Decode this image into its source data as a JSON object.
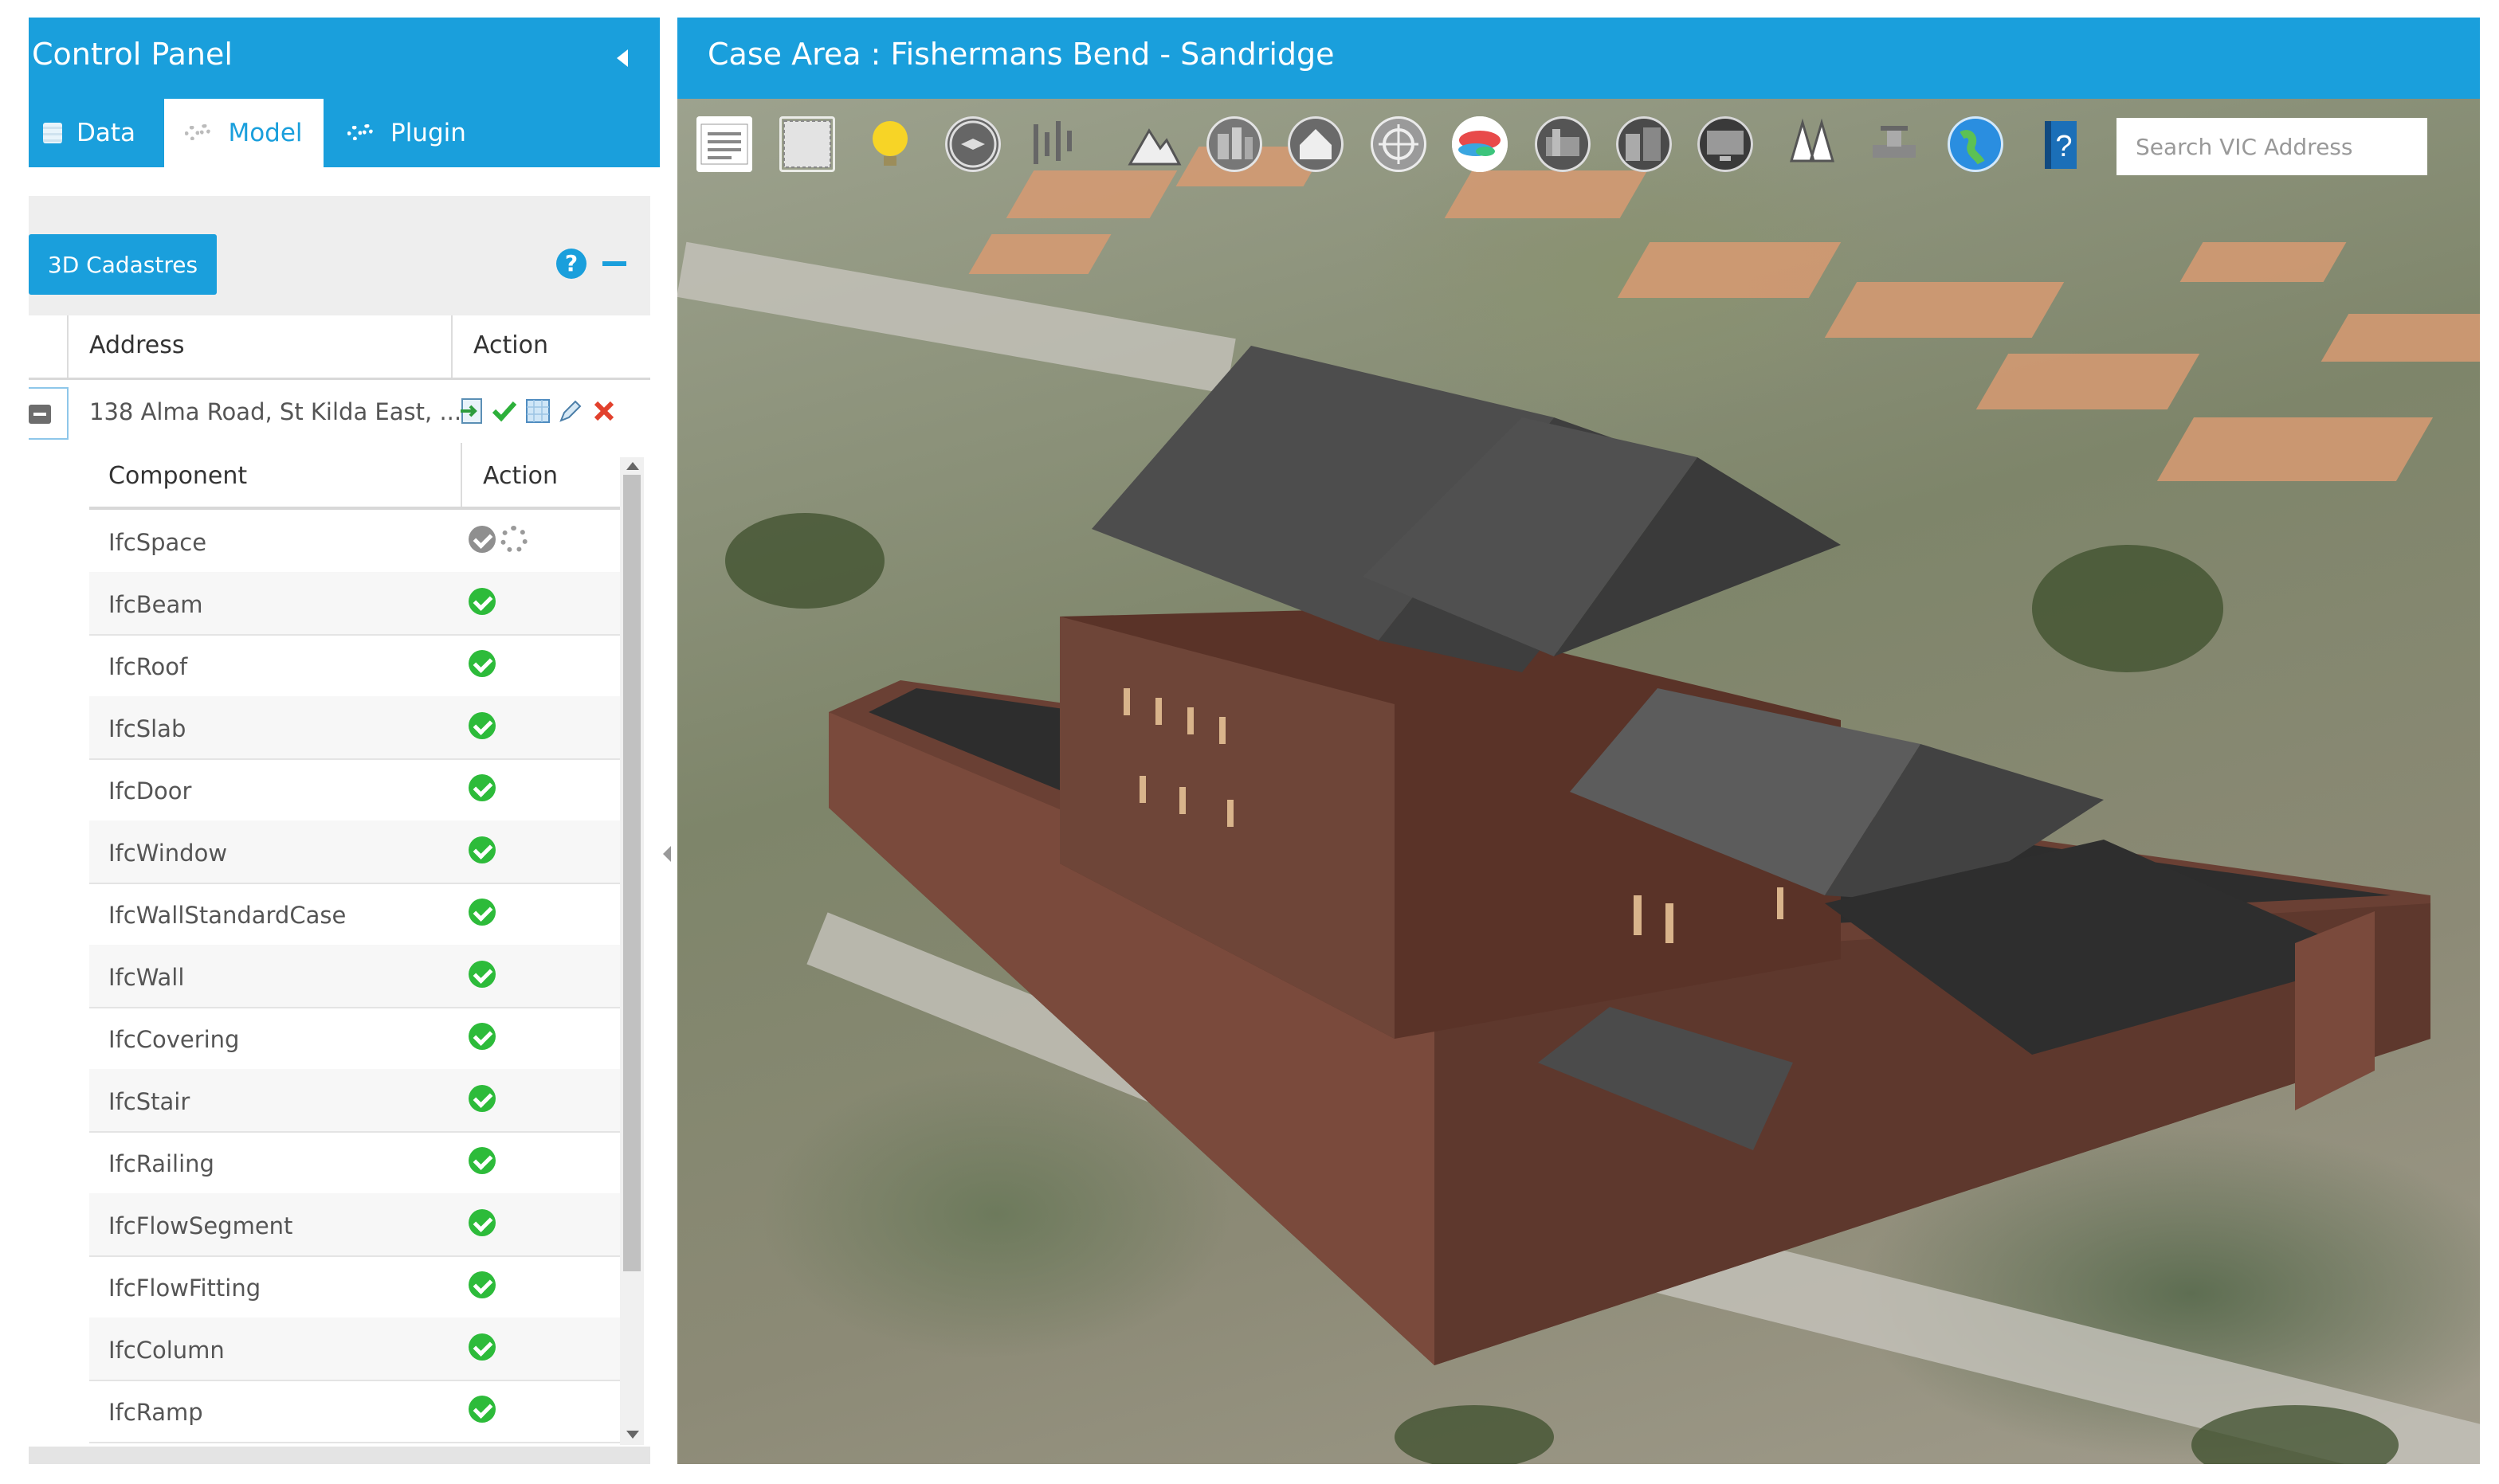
{
  "control_panel": {
    "title": "Control Panel",
    "tabs": [
      {
        "label": "Data",
        "icon": "data-icon"
      },
      {
        "label": "Model",
        "icon": "gears-icon",
        "active": true
      },
      {
        "label": "Plugin",
        "icon": "gears-icon"
      }
    ],
    "cadastre_button": "3D Cadastres",
    "help_symbol": "?",
    "address_table": {
      "columns": [
        "Address",
        "Action"
      ],
      "rows": [
        {
          "address": "138 Alma Road, St Kilda East, ...",
          "actions": [
            "import-icon",
            "check-icon",
            "grid-icon",
            "edit-icon",
            "delete-icon"
          ]
        }
      ]
    },
    "component_table": {
      "columns": [
        "Component",
        "Action"
      ],
      "rows": [
        {
          "name": "IfcSpace",
          "status": "pending"
        },
        {
          "name": "IfcBeam",
          "status": "ok"
        },
        {
          "name": "IfcRoof",
          "status": "ok"
        },
        {
          "name": "IfcSlab",
          "status": "ok"
        },
        {
          "name": "IfcDoor",
          "status": "ok"
        },
        {
          "name": "IfcWindow",
          "status": "ok"
        },
        {
          "name": "IfcWallStandardCase",
          "status": "ok"
        },
        {
          "name": "IfcWall",
          "status": "ok"
        },
        {
          "name": "IfcCovering",
          "status": "ok"
        },
        {
          "name": "IfcStair",
          "status": "ok"
        },
        {
          "name": "IfcRailing",
          "status": "ok"
        },
        {
          "name": "IfcFlowSegment",
          "status": "ok"
        },
        {
          "name": "IfcFlowFitting",
          "status": "ok"
        },
        {
          "name": "IfcColumn",
          "status": "ok"
        },
        {
          "name": "IfcRamp",
          "status": "ok"
        }
      ]
    }
  },
  "map": {
    "case_title": "Case Area : Fishermans Bend - Sandridge",
    "search_placeholder": "Search VIC Address",
    "toolbar": [
      "legend-icon",
      "grid-layer-icon",
      "lightbulb-icon",
      "compass-icon",
      "chart-icon",
      "terrain-icon",
      "buildings-icon",
      "home-icon",
      "target-icon",
      "heatmap-icon",
      "city-icon",
      "city-photo-icon",
      "monitor-icon",
      "trees-icon",
      "valve-icon",
      "globe-icon",
      "help-icon"
    ]
  },
  "colors": {
    "accent": "#1a9fdc",
    "ok": "#2dbb3a",
    "building_wall": "#6e4538",
    "building_roof": "#4a4a4a"
  }
}
